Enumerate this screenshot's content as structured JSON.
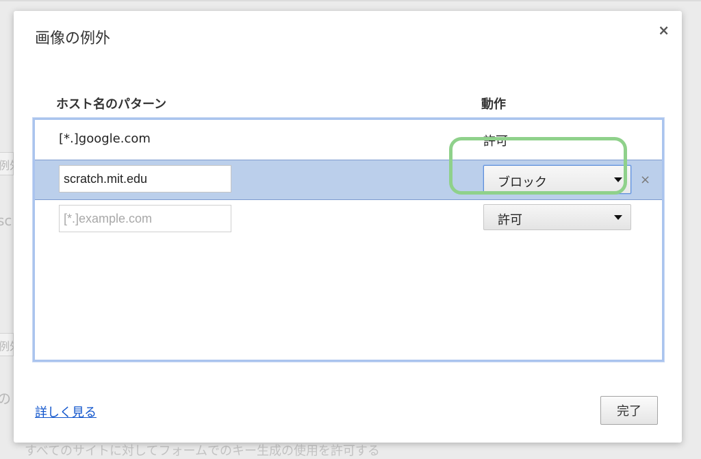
{
  "dialog": {
    "title": "画像の例外",
    "close_glyph": "×"
  },
  "columns": {
    "host": "ホスト名のパターン",
    "action": "動作"
  },
  "exceptions": [
    {
      "host": "[*.]google.com",
      "action": "許可"
    },
    {
      "host": "scratch.mit.edu",
      "action": "ブロック",
      "delete_glyph": "×"
    }
  ],
  "new_row": {
    "host_placeholder": "[*.]example.com",
    "action": "許可"
  },
  "footer": {
    "learn_more": "詳しく見る",
    "done": "完了"
  },
  "background_fragments": [
    "例外",
    "sc",
    "例外",
    "の",
    "すべてのサイトに対してフォームでのキー生成の使用を許可する"
  ],
  "colors": {
    "selected_row": "#bbcfeb",
    "list_border": "#aac4ee",
    "highlight_ring": "#8fd18b",
    "link": "#1155cc"
  },
  "icons": [
    "close-icon",
    "dropdown-caret-icon",
    "delete-row-icon"
  ]
}
